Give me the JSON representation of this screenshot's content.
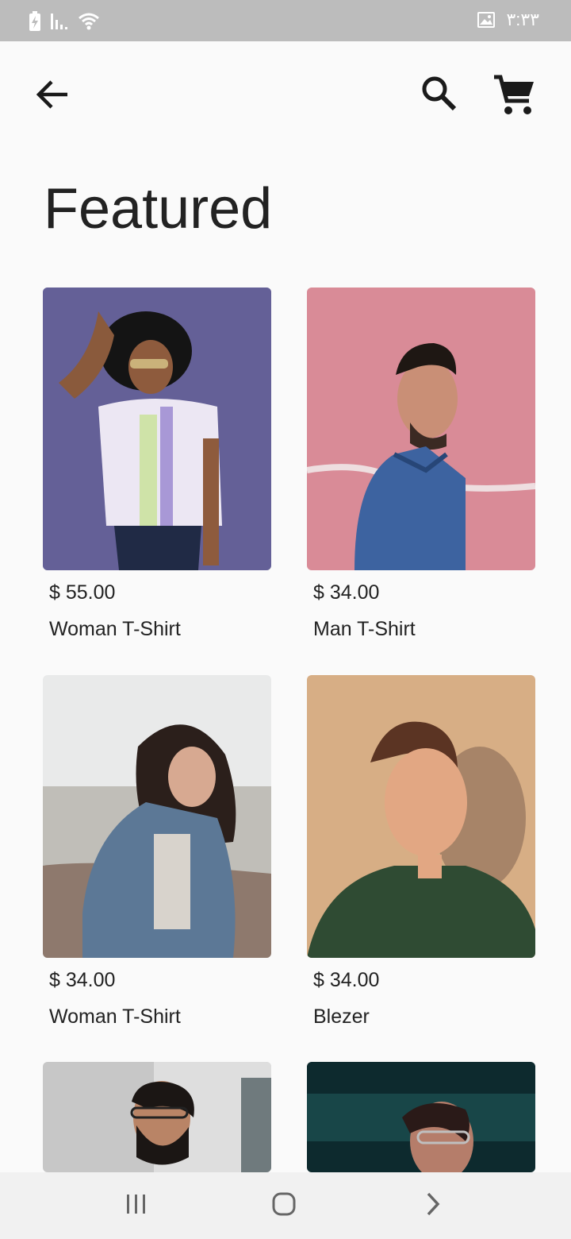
{
  "status_bar": {
    "time": "۳:۳۳",
    "icons": [
      "battery-charging-icon",
      "signal-icon",
      "wifi-icon",
      "gallery-notification-icon"
    ]
  },
  "app_bar": {
    "back_icon": "arrow-back-icon",
    "search_icon": "search-icon",
    "cart_icon": "shopping-cart-icon"
  },
  "page": {
    "title": "Featured"
  },
  "products": [
    {
      "price": "$ 55.00",
      "name": "Woman T-Shirt",
      "photo": "woman-curly-hair-purple-wall"
    },
    {
      "price": "$ 34.00",
      "name": "Man T-Shirt",
      "photo": "man-denim-shirt-pink-wall"
    },
    {
      "price": "$ 34.00",
      "name": "Woman T-Shirt",
      "photo": "woman-denim-jacket-outdoors"
    },
    {
      "price": "$ 34.00",
      "name": "Blezer",
      "photo": "woman-green-jacket-beige-wall"
    },
    {
      "price": "",
      "name": "",
      "photo": "man-glasses-beard"
    },
    {
      "price": "",
      "name": "",
      "photo": "woman-glasses-dark-teal"
    }
  ],
  "nav_bar": {
    "icons": [
      "recent-apps-icon",
      "home-icon",
      "back-nav-icon"
    ]
  },
  "colors": {
    "background": "#fafafa",
    "status_bar": "#bcbcbc",
    "nav_bar": "#f1f1f1",
    "text": "#222222"
  }
}
